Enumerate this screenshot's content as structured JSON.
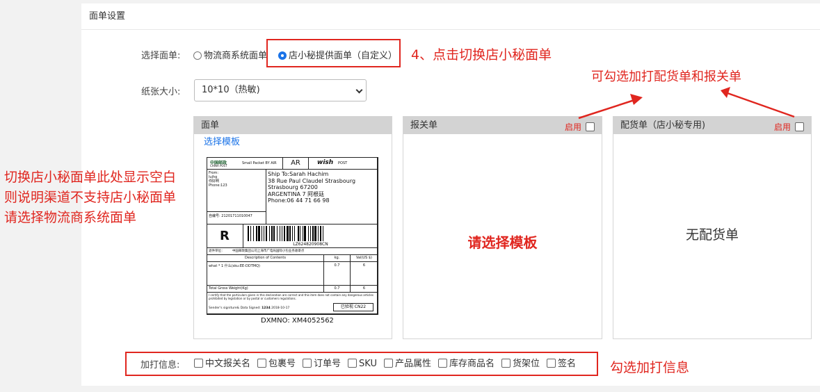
{
  "panel": {
    "title": "面单设置"
  },
  "select_sheet": {
    "label": "选择面单:",
    "options": [
      "物流商系统面单",
      "店小秘提供面单（自定义）"
    ],
    "selected_index": 1
  },
  "paper": {
    "label": "纸张大小:",
    "value": "10*10（热敏)"
  },
  "columns": {
    "sheet": {
      "title": "面单",
      "choose_template": "选择模板"
    },
    "customs": {
      "title": "报关单",
      "enable": "启用",
      "placeholder": "请选择模板"
    },
    "picking": {
      "title": "配货单（店小秘专用)",
      "enable": "启用",
      "placeholder": "无配货单"
    }
  },
  "label_preview": {
    "post_logo": "中国邮政",
    "post_sub": "CHINA POST",
    "packet_type": "Small Packet BY AIR",
    "country_code": "AR",
    "wish": "wish",
    "wish_post": "POST",
    "from_lines": [
      "From:",
      "lujhg",
      "你好啊",
      "Phone:123"
    ],
    "ship_to": [
      "Ship To:Sarah Hachim",
      "38 Rue Paul Claudel  Strasbourg",
      "Strasbourg 67200",
      "ARGENTINA  7  阿根廷",
      "Phone:06 44 71 66 98"
    ],
    "self_no": "自编号: 21201711010047",
    "r_mark": "R",
    "tracking": "LZ624820908CN",
    "return_unit_label": "退件单位：",
    "return_unit": "中国邮政集团公司上海市广电局国际小包业务收寄点",
    "table_headers": [
      "Description of Contents",
      "kg.",
      "Val(US $)"
    ],
    "item_desc": "what * 1 什么(sku:EE-DDTMQ)",
    "item_kg": "0.7",
    "item_val": "6",
    "total_label": "Total Gross Weight(Kg)",
    "total_kg": "0.7",
    "total_val": "6",
    "declaration": "I certify that the particulars given in this declaration are correct and this item does not contain any dangerous articles prohibited by legislation or by postal or customers regulations.",
    "signature_label": "Sender's signiture& Data Signed:",
    "signature_name": "1234",
    "signature_date": "2018-10-17",
    "checked_stamp": "已验视 CN22",
    "dxm_no": "DXMNO: XM4052562"
  },
  "addon": {
    "label": "加打信息:",
    "options": [
      "中文报关名",
      "包裹号",
      "订单号",
      "SKU",
      "产品属性",
      "库存商品名",
      "货架位",
      "签名"
    ]
  },
  "annotations": {
    "step4": "4、点击切换店小秘面单",
    "optional": "可勾选加打配货单和报关单",
    "left_note": [
      "切换店小秘面单此处显示空白",
      "则说明渠道不支持店小秘面单",
      "请选择物流商系统面单"
    ],
    "addon_note": "勾选加打信息"
  },
  "colors": {
    "annotation": "#e0261f",
    "link": "#1a73e8",
    "header_bg": "#d3d3d3"
  }
}
